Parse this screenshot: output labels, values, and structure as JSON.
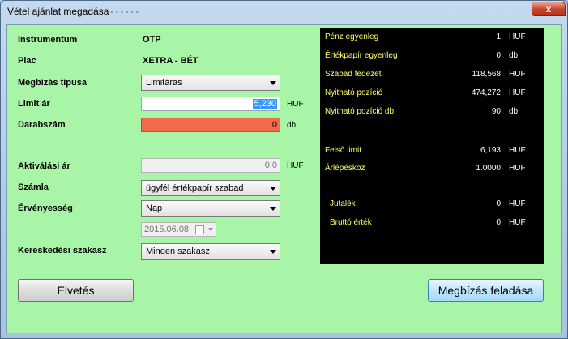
{
  "window": {
    "title": "Vétel ajánlat megadása",
    "close": "x"
  },
  "form": {
    "instrument": {
      "label": "Instrumentum",
      "value": "OTP"
    },
    "market": {
      "label": "Piac",
      "value": "XETRA - BÉT"
    },
    "order_type": {
      "label": "Megbízás típusa",
      "value": "Limitáras"
    },
    "limit_price": {
      "label": "Limit ár",
      "value": "5,230",
      "unit": "HUF"
    },
    "quantity": {
      "label": "Darabszám",
      "value": "0",
      "unit": "db"
    },
    "activation_price": {
      "label": "Aktiválási ár",
      "value": "0.0",
      "unit": "HUF"
    },
    "account": {
      "label": "Számla",
      "value": "ügyfél értékpapír szabad"
    },
    "validity": {
      "label": "Érvényesség",
      "value": "Nap"
    },
    "date": {
      "value": "2015.06.08"
    },
    "session": {
      "label": "Kereskedési szakasz",
      "value": "Minden szakasz"
    }
  },
  "info": {
    "rows": [
      {
        "label": "Pénz egyenleg",
        "value": "1",
        "unit": "HUF"
      },
      {
        "label": "Értékpapír egyenleg",
        "value": "0",
        "unit": "db"
      },
      {
        "label": "Szabad fedezet",
        "value": "118,568",
        "unit": "HUF"
      },
      {
        "label": "Nyitható pozíció",
        "value": "474,272",
        "unit": "HUF"
      },
      {
        "label": "Nyitható pozíció db",
        "value": "90",
        "unit": "db"
      },
      {
        "label": "Felső limit",
        "value": "6,193",
        "unit": "HUF"
      },
      {
        "label": "Árlépésköz",
        "value": "1.0000",
        "unit": "HUF"
      },
      {
        "label": "Jutalék",
        "value": "0",
        "unit": "HUF"
      },
      {
        "label": "Bruttó érték",
        "value": "0",
        "unit": "HUF"
      }
    ]
  },
  "buttons": {
    "cancel": "Elvetés",
    "submit": "Megbízás feladása"
  },
  "colors": {
    "background": "#a8f5a8",
    "panel": "#000000",
    "panel_label": "#ffff66",
    "quantity_error": "#f26b4f",
    "selection": "#3399ff"
  }
}
